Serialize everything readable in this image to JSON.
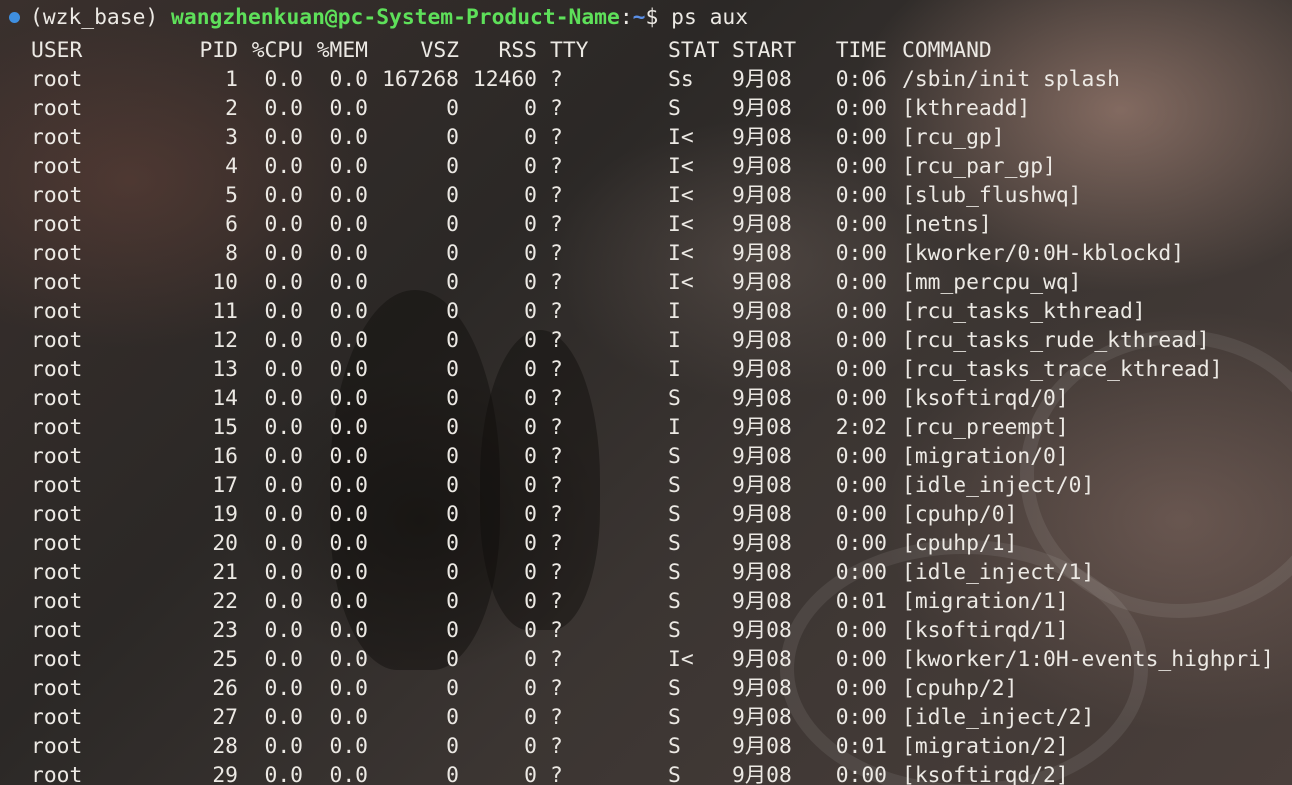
{
  "prompt": {
    "env": "(wzk_base)",
    "user_host": "wangzhenkuan@pc-System-Product-Name",
    "separator": ":",
    "path": "~",
    "symbol": "$",
    "command": "ps aux"
  },
  "colors": {
    "prompt_user": "#5ee05a",
    "prompt_path": "#5a8fe6",
    "status_dot": "#3f8fe0",
    "text": "#ece9e4"
  },
  "table": {
    "headers": [
      "USER",
      "PID",
      "%CPU",
      "%MEM",
      "VSZ",
      "RSS",
      "TTY",
      "STAT",
      "START",
      "TIME",
      "COMMAND"
    ],
    "rows": [
      [
        "root",
        "1",
        "0.0",
        "0.0",
        "167268",
        "12460",
        "?",
        "Ss",
        "9月08",
        "0:06",
        "/sbin/init splash"
      ],
      [
        "root",
        "2",
        "0.0",
        "0.0",
        "0",
        "0",
        "?",
        "S",
        "9月08",
        "0:00",
        "[kthreadd]"
      ],
      [
        "root",
        "3",
        "0.0",
        "0.0",
        "0",
        "0",
        "?",
        "I<",
        "9月08",
        "0:00",
        "[rcu_gp]"
      ],
      [
        "root",
        "4",
        "0.0",
        "0.0",
        "0",
        "0",
        "?",
        "I<",
        "9月08",
        "0:00",
        "[rcu_par_gp]"
      ],
      [
        "root",
        "5",
        "0.0",
        "0.0",
        "0",
        "0",
        "?",
        "I<",
        "9月08",
        "0:00",
        "[slub_flushwq]"
      ],
      [
        "root",
        "6",
        "0.0",
        "0.0",
        "0",
        "0",
        "?",
        "I<",
        "9月08",
        "0:00",
        "[netns]"
      ],
      [
        "root",
        "8",
        "0.0",
        "0.0",
        "0",
        "0",
        "?",
        "I<",
        "9月08",
        "0:00",
        "[kworker/0:0H-kblockd]"
      ],
      [
        "root",
        "10",
        "0.0",
        "0.0",
        "0",
        "0",
        "?",
        "I<",
        "9月08",
        "0:00",
        "[mm_percpu_wq]"
      ],
      [
        "root",
        "11",
        "0.0",
        "0.0",
        "0",
        "0",
        "?",
        "I",
        "9月08",
        "0:00",
        "[rcu_tasks_kthread]"
      ],
      [
        "root",
        "12",
        "0.0",
        "0.0",
        "0",
        "0",
        "?",
        "I",
        "9月08",
        "0:00",
        "[rcu_tasks_rude_kthread]"
      ],
      [
        "root",
        "13",
        "0.0",
        "0.0",
        "0",
        "0",
        "?",
        "I",
        "9月08",
        "0:00",
        "[rcu_tasks_trace_kthread]"
      ],
      [
        "root",
        "14",
        "0.0",
        "0.0",
        "0",
        "0",
        "?",
        "S",
        "9月08",
        "0:00",
        "[ksoftirqd/0]"
      ],
      [
        "root",
        "15",
        "0.0",
        "0.0",
        "0",
        "0",
        "?",
        "I",
        "9月08",
        "2:02",
        "[rcu_preempt]"
      ],
      [
        "root",
        "16",
        "0.0",
        "0.0",
        "0",
        "0",
        "?",
        "S",
        "9月08",
        "0:00",
        "[migration/0]"
      ],
      [
        "root",
        "17",
        "0.0",
        "0.0",
        "0",
        "0",
        "?",
        "S",
        "9月08",
        "0:00",
        "[idle_inject/0]"
      ],
      [
        "root",
        "19",
        "0.0",
        "0.0",
        "0",
        "0",
        "?",
        "S",
        "9月08",
        "0:00",
        "[cpuhp/0]"
      ],
      [
        "root",
        "20",
        "0.0",
        "0.0",
        "0",
        "0",
        "?",
        "S",
        "9月08",
        "0:00",
        "[cpuhp/1]"
      ],
      [
        "root",
        "21",
        "0.0",
        "0.0",
        "0",
        "0",
        "?",
        "S",
        "9月08",
        "0:00",
        "[idle_inject/1]"
      ],
      [
        "root",
        "22",
        "0.0",
        "0.0",
        "0",
        "0",
        "?",
        "S",
        "9月08",
        "0:01",
        "[migration/1]"
      ],
      [
        "root",
        "23",
        "0.0",
        "0.0",
        "0",
        "0",
        "?",
        "S",
        "9月08",
        "0:00",
        "[ksoftirqd/1]"
      ],
      [
        "root",
        "25",
        "0.0",
        "0.0",
        "0",
        "0",
        "?",
        "I<",
        "9月08",
        "0:00",
        "[kworker/1:0H-events_highpri]"
      ],
      [
        "root",
        "26",
        "0.0",
        "0.0",
        "0",
        "0",
        "?",
        "S",
        "9月08",
        "0:00",
        "[cpuhp/2]"
      ],
      [
        "root",
        "27",
        "0.0",
        "0.0",
        "0",
        "0",
        "?",
        "S",
        "9月08",
        "0:00",
        "[idle_inject/2]"
      ],
      [
        "root",
        "28",
        "0.0",
        "0.0",
        "0",
        "0",
        "?",
        "S",
        "9月08",
        "0:01",
        "[migration/2]"
      ],
      [
        "root",
        "29",
        "0.0",
        "0.0",
        "0",
        "0",
        "?",
        "S",
        "9月08",
        "0:00",
        "[ksoftirqd/2]"
      ]
    ]
  }
}
